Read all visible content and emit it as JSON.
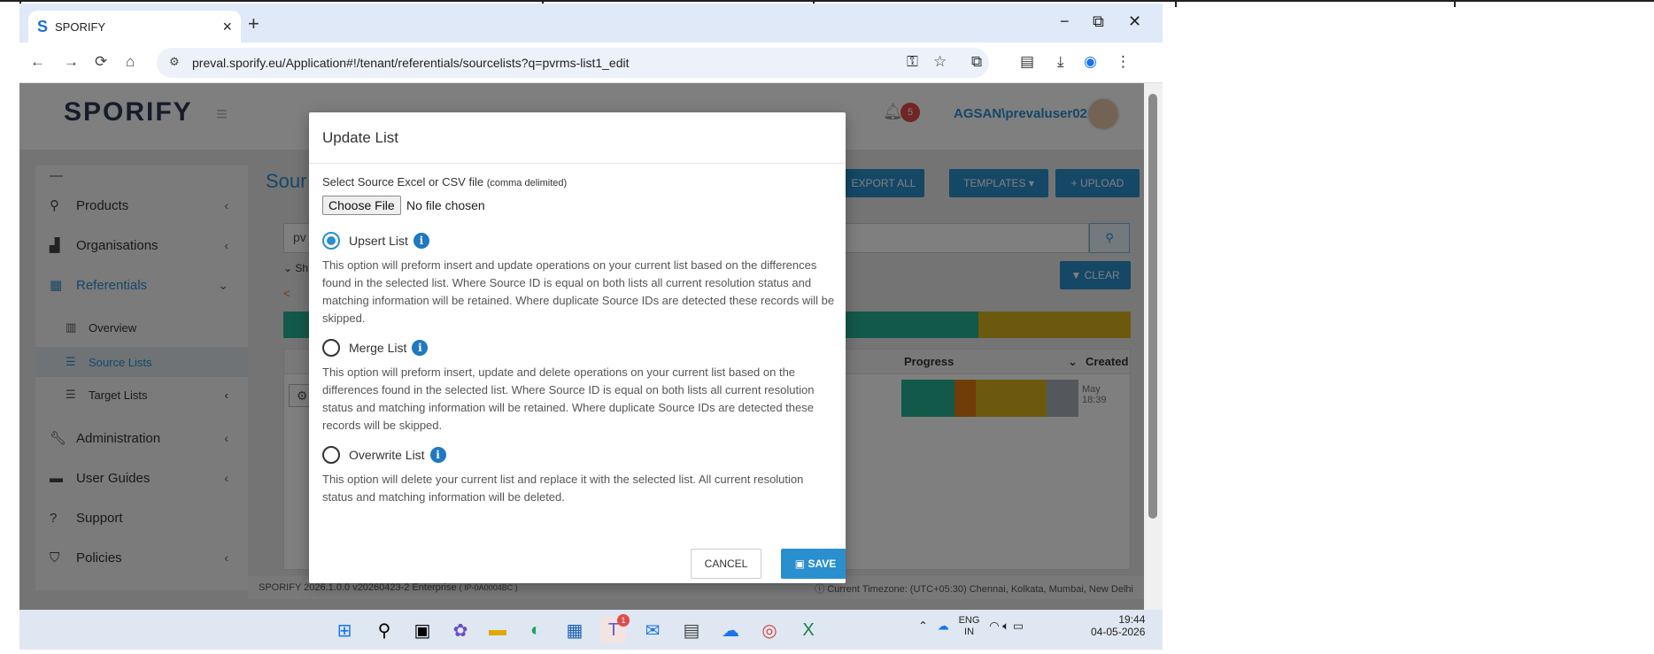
{
  "browser": {
    "tab_title": "SPORIFY",
    "new_tab": "+",
    "minimize": "−",
    "restore": "⧉",
    "close": "✕",
    "url": "preval.sporify.eu/Application#!/tenant/referentials/sourcelists?q=pvrms-list1_edit"
  },
  "app": {
    "logo": "SPORIFY",
    "notification_count": "5",
    "username": "AGSAN\\prevaluser02",
    "page_title_partial": "Sour",
    "buttons": {
      "export_all": "EXPORT ALL",
      "templates": "TEMPLATES ▾",
      "upload": "+ UPLOAD",
      "clear": "CLEAR"
    },
    "search_value": "pv",
    "show_label": "⌄ Sh",
    "table_headers": {
      "progress": "Progress",
      "created": "Created"
    },
    "created_value": "May",
    "created_time": "18:39",
    "footer_version": "SPORIFY 2026.1.0.0 v20260423-2 Enterprise",
    "footer_ip": "( IP-0A0004BC )",
    "footer_timezone": "Current Timezone: (UTC+05:30) Chennai, Kolkata, Mumbai, New Delhi"
  },
  "sidebar": {
    "items": [
      {
        "label": "Products",
        "icon": "products-icon"
      },
      {
        "label": "Organisations",
        "icon": "organisations-icon"
      },
      {
        "label": "Referentials",
        "icon": "referentials-icon"
      },
      {
        "label": "Overview",
        "icon": "overview-icon"
      },
      {
        "label": "Source Lists",
        "icon": "list-icon"
      },
      {
        "label": "Target Lists",
        "icon": "list-icon"
      },
      {
        "label": "Administration",
        "icon": "wrench-icon"
      },
      {
        "label": "User Guides",
        "icon": "book-icon"
      },
      {
        "label": "Support",
        "icon": "question-icon"
      },
      {
        "label": "Policies",
        "icon": "shield-icon"
      }
    ]
  },
  "modal": {
    "title": "Update List",
    "file_label": "Select Source Excel or CSV file",
    "file_label_note": "(comma delimited)",
    "choose_file": "Choose File",
    "no_file": "No file chosen",
    "options": [
      {
        "label": "Upsert List",
        "selected": true,
        "description": "This option will preform insert and update operations on your current list based on the differences found in the selected list. Where Source ID is equal on both lists all current resolution status and matching information will be retained. Where duplicate Source IDs are detected these records will be skipped."
      },
      {
        "label": "Merge List",
        "selected": false,
        "description": "This option will preform insert, update and delete operations on your current list based on the differences found in the selected list. Where Source ID is equal on both lists all current resolution status and matching information will be retained. Where duplicate Source IDs are detected these records will be skipped."
      },
      {
        "label": "Overwrite List",
        "selected": false,
        "description": "This option will delete your current list and replace it with the selected list. All current resolution status and matching information will be deleted."
      }
    ],
    "cancel": "CANCEL",
    "save": "SAVE"
  },
  "taskbar": {
    "lang_top": "ENG",
    "lang_bottom": "IN",
    "time": "19:44",
    "date": "04-05-2026",
    "teams_badge": "1"
  },
  "colors": {
    "accent": "#2a8fcf",
    "progress_green": "#26b295",
    "progress_orange": "#e07a10",
    "progress_yellow": "#d9b21c",
    "progress_gray": "#a9b1bb"
  }
}
